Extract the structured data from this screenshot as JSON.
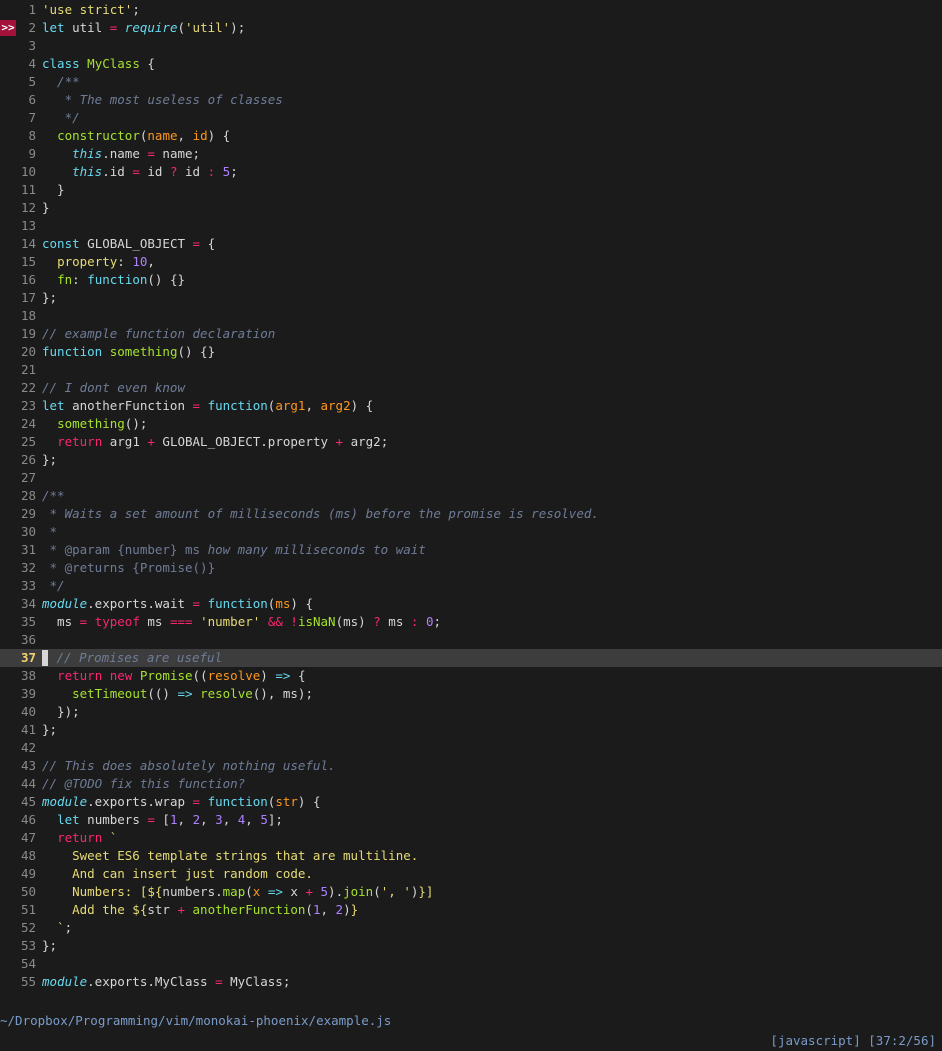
{
  "editor": {
    "lines": [
      [
        [
          "t-string",
          "'use strict'"
        ],
        [
          "t-plain",
          ";"
        ]
      ],
      [
        [
          "t-kw",
          "let"
        ],
        [
          "t-plain",
          " util "
        ],
        [
          "t-op",
          "="
        ],
        [
          "t-plain",
          " "
        ],
        [
          "t-italic",
          "require"
        ],
        [
          "t-plain",
          "("
        ],
        [
          "t-string",
          "'util'"
        ],
        [
          "t-plain",
          ");"
        ]
      ],
      [],
      [
        [
          "t-kw",
          "class"
        ],
        [
          "t-plain",
          " "
        ],
        [
          "t-fn",
          "MyClass"
        ],
        [
          "t-plain",
          " {"
        ]
      ],
      [
        [
          "t-comment",
          "  /**"
        ]
      ],
      [
        [
          "t-comment",
          "   * The most useless of classes"
        ]
      ],
      [
        [
          "t-comment",
          "   */"
        ]
      ],
      [
        [
          "t-plain",
          "  "
        ],
        [
          "t-fn",
          "constructor"
        ],
        [
          "t-plain",
          "("
        ],
        [
          "t-param",
          "name"
        ],
        [
          "t-plain",
          ", "
        ],
        [
          "t-param",
          "id"
        ],
        [
          "t-plain",
          ") {"
        ]
      ],
      [
        [
          "t-plain",
          "    "
        ],
        [
          "t-italic",
          "this"
        ],
        [
          "t-plain",
          ".name "
        ],
        [
          "t-op",
          "="
        ],
        [
          "t-plain",
          " name;"
        ]
      ],
      [
        [
          "t-plain",
          "    "
        ],
        [
          "t-italic",
          "this"
        ],
        [
          "t-plain",
          ".id "
        ],
        [
          "t-op",
          "="
        ],
        [
          "t-plain",
          " id "
        ],
        [
          "t-op",
          "?"
        ],
        [
          "t-plain",
          " id "
        ],
        [
          "t-op",
          ":"
        ],
        [
          "t-plain",
          " "
        ],
        [
          "t-num",
          "5"
        ],
        [
          "t-plain",
          ";"
        ]
      ],
      [
        [
          "t-plain",
          "  }"
        ]
      ],
      [
        [
          "t-plain",
          "}"
        ]
      ],
      [],
      [
        [
          "t-kw",
          "const"
        ],
        [
          "t-plain",
          " GLOBAL_OBJECT "
        ],
        [
          "t-op",
          "="
        ],
        [
          "t-plain",
          " {"
        ]
      ],
      [
        [
          "t-plain",
          "  "
        ],
        [
          "t-prop",
          "property"
        ],
        [
          "t-plain",
          ": "
        ],
        [
          "t-num",
          "10"
        ],
        [
          "t-plain",
          ","
        ]
      ],
      [
        [
          "t-plain",
          "  "
        ],
        [
          "t-fn",
          "fn"
        ],
        [
          "t-plain",
          ": "
        ],
        [
          "t-kw",
          "function"
        ],
        [
          "t-plain",
          "() {}"
        ]
      ],
      [
        [
          "t-plain",
          "};"
        ]
      ],
      [],
      [
        [
          "t-comment",
          "// example function declaration"
        ]
      ],
      [
        [
          "t-kw",
          "function"
        ],
        [
          "t-plain",
          " "
        ],
        [
          "t-fn",
          "something"
        ],
        [
          "t-plain",
          "() {}"
        ]
      ],
      [],
      [
        [
          "t-comment",
          "// I dont even know"
        ]
      ],
      [
        [
          "t-kw",
          "let"
        ],
        [
          "t-plain",
          " anotherFunction "
        ],
        [
          "t-op",
          "="
        ],
        [
          "t-plain",
          " "
        ],
        [
          "t-kw",
          "function"
        ],
        [
          "t-plain",
          "("
        ],
        [
          "t-param",
          "arg1"
        ],
        [
          "t-plain",
          ", "
        ],
        [
          "t-param",
          "arg2"
        ],
        [
          "t-plain",
          ") {"
        ]
      ],
      [
        [
          "t-plain",
          "  "
        ],
        [
          "t-fn",
          "something"
        ],
        [
          "t-plain",
          "();"
        ]
      ],
      [
        [
          "t-plain",
          "  "
        ],
        [
          "t-op",
          "return"
        ],
        [
          "t-plain",
          " arg1 "
        ],
        [
          "t-op",
          "+"
        ],
        [
          "t-plain",
          " GLOBAL_OBJECT.property "
        ],
        [
          "t-op",
          "+"
        ],
        [
          "t-plain",
          " arg2;"
        ]
      ],
      [
        [
          "t-plain",
          "};"
        ]
      ],
      [],
      [
        [
          "t-comment",
          "/**"
        ]
      ],
      [
        [
          "t-comment",
          " * Waits a set amount of milliseconds (ms) before the promise is resolved."
        ]
      ],
      [
        [
          "t-comment",
          " *"
        ]
      ],
      [
        [
          "t-comment",
          " * "
        ],
        [
          "t-doc",
          "@param {number} ms"
        ],
        [
          "t-comment",
          " how many milliseconds to wait"
        ]
      ],
      [
        [
          "t-comment",
          " * "
        ],
        [
          "t-doc",
          "@returns {Promise()}"
        ]
      ],
      [
        [
          "t-comment",
          " */"
        ]
      ],
      [
        [
          "t-italic",
          "module"
        ],
        [
          "t-plain",
          ".exports.wait "
        ],
        [
          "t-op",
          "="
        ],
        [
          "t-plain",
          " "
        ],
        [
          "t-kw",
          "function"
        ],
        [
          "t-plain",
          "("
        ],
        [
          "t-param",
          "ms"
        ],
        [
          "t-plain",
          ") {"
        ]
      ],
      [
        [
          "t-plain",
          "  ms "
        ],
        [
          "t-op",
          "="
        ],
        [
          "t-plain",
          " "
        ],
        [
          "t-op",
          "typeof"
        ],
        [
          "t-plain",
          " ms "
        ],
        [
          "t-op",
          "==="
        ],
        [
          "t-plain",
          " "
        ],
        [
          "t-string",
          "'number'"
        ],
        [
          "t-plain",
          " "
        ],
        [
          "t-op",
          "&&"
        ],
        [
          "t-plain",
          " "
        ],
        [
          "t-op",
          "!"
        ],
        [
          "t-fn",
          "isNaN"
        ],
        [
          "t-plain",
          "(ms) "
        ],
        [
          "t-op",
          "?"
        ],
        [
          "t-plain",
          " ms "
        ],
        [
          "t-op",
          ":"
        ],
        [
          "t-plain",
          " "
        ],
        [
          "t-num",
          "0"
        ],
        [
          "t-plain",
          ";"
        ]
      ],
      [],
      [
        [
          "t-comment",
          "  // Promises are useful"
        ]
      ],
      [
        [
          "t-plain",
          "  "
        ],
        [
          "t-op",
          "return"
        ],
        [
          "t-plain",
          " "
        ],
        [
          "t-op",
          "new"
        ],
        [
          "t-plain",
          " "
        ],
        [
          "t-fn",
          "Promise"
        ],
        [
          "t-plain",
          "(("
        ],
        [
          "t-param",
          "resolve"
        ],
        [
          "t-plain",
          ") "
        ],
        [
          "t-kw",
          "=>"
        ],
        [
          "t-plain",
          " {"
        ]
      ],
      [
        [
          "t-plain",
          "    "
        ],
        [
          "t-fn",
          "setTimeout"
        ],
        [
          "t-plain",
          "(() "
        ],
        [
          "t-kw",
          "=>"
        ],
        [
          "t-plain",
          " "
        ],
        [
          "t-fn",
          "resolve"
        ],
        [
          "t-plain",
          "(), ms);"
        ]
      ],
      [
        [
          "t-plain",
          "  });"
        ]
      ],
      [
        [
          "t-plain",
          "};"
        ]
      ],
      [],
      [
        [
          "t-comment",
          "// This does absolutely nothing useful."
        ]
      ],
      [
        [
          "t-comment",
          "// @TODO fix this function?"
        ]
      ],
      [
        [
          "t-italic",
          "module"
        ],
        [
          "t-plain",
          ".exports.wrap "
        ],
        [
          "t-op",
          "="
        ],
        [
          "t-plain",
          " "
        ],
        [
          "t-kw",
          "function"
        ],
        [
          "t-plain",
          "("
        ],
        [
          "t-param",
          "str"
        ],
        [
          "t-plain",
          ") {"
        ]
      ],
      [
        [
          "t-plain",
          "  "
        ],
        [
          "t-kw",
          "let"
        ],
        [
          "t-plain",
          " numbers "
        ],
        [
          "t-op",
          "="
        ],
        [
          "t-plain",
          " ["
        ],
        [
          "t-num",
          "1"
        ],
        [
          "t-plain",
          ", "
        ],
        [
          "t-num",
          "2"
        ],
        [
          "t-plain",
          ", "
        ],
        [
          "t-num",
          "3"
        ],
        [
          "t-plain",
          ", "
        ],
        [
          "t-num",
          "4"
        ],
        [
          "t-plain",
          ", "
        ],
        [
          "t-num",
          "5"
        ],
        [
          "t-plain",
          "];"
        ]
      ],
      [
        [
          "t-plain",
          "  "
        ],
        [
          "t-op",
          "return"
        ],
        [
          "t-plain",
          " "
        ],
        [
          "t-string",
          "`"
        ]
      ],
      [
        [
          "t-string",
          "    Sweet ES6 template strings that are multiline."
        ]
      ],
      [
        [
          "t-string",
          "    And can insert just random code."
        ]
      ],
      [
        [
          "t-string",
          "    Numbers: [${"
        ],
        [
          "t-plain",
          "numbers."
        ],
        [
          "t-fn",
          "map"
        ],
        [
          "t-plain",
          "("
        ],
        [
          "t-param",
          "x"
        ],
        [
          "t-plain",
          " "
        ],
        [
          "t-kw",
          "=>"
        ],
        [
          "t-plain",
          " x "
        ],
        [
          "t-op",
          "+"
        ],
        [
          "t-plain",
          " "
        ],
        [
          "t-num",
          "5"
        ],
        [
          "t-plain",
          ")."
        ],
        [
          "t-fn",
          "join"
        ],
        [
          "t-plain",
          "("
        ],
        [
          "t-string",
          "', '"
        ],
        [
          "t-plain",
          ")"
        ],
        [
          "t-string",
          "}]"
        ]
      ],
      [
        [
          "t-string",
          "    Add the ${"
        ],
        [
          "t-plain",
          "str "
        ],
        [
          "t-op",
          "+"
        ],
        [
          "t-plain",
          " "
        ],
        [
          "t-fn",
          "anotherFunction"
        ],
        [
          "t-plain",
          "("
        ],
        [
          "t-num",
          "1"
        ],
        [
          "t-plain",
          ", "
        ],
        [
          "t-num",
          "2"
        ],
        [
          "t-plain",
          ")"
        ],
        [
          "t-string",
          "}"
        ]
      ],
      [
        [
          "t-string",
          "  `"
        ],
        [
          "t-plain",
          ";"
        ]
      ],
      [
        [
          "t-plain",
          "};"
        ]
      ],
      [],
      [
        [
          "t-italic",
          "module"
        ],
        [
          "t-plain",
          ".exports.MyClass "
        ],
        [
          "t-op",
          "="
        ],
        [
          "t-plain",
          " MyClass;"
        ]
      ]
    ],
    "sign": {
      "line": 2,
      "text": ">>",
      "color": "#a3123a"
    },
    "cursor_line": 37
  },
  "statusline": {
    "path": "~/Dropbox/Programming/vim/monokai-phoenix/example.js",
    "filetype": "[javascript]",
    "position": "[37:2/56]"
  }
}
